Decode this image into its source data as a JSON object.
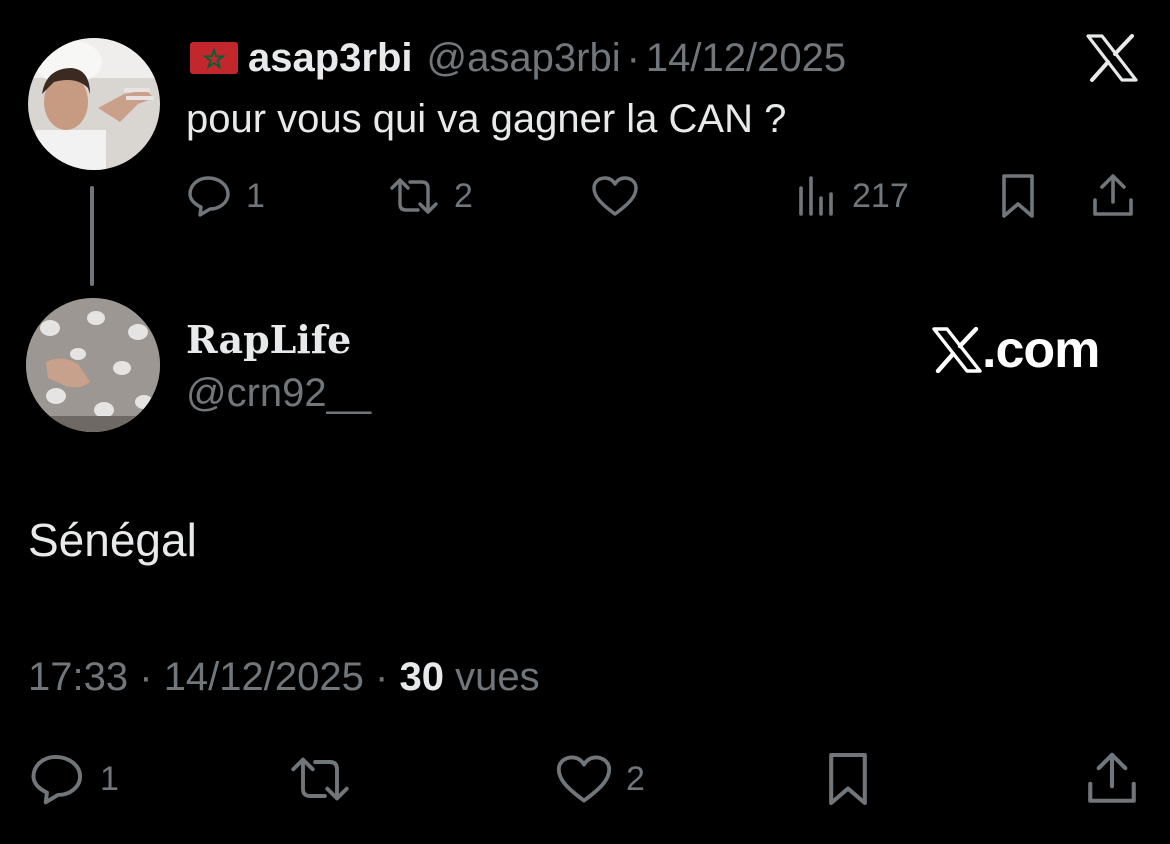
{
  "parent_tweet": {
    "author_name": "asap3rbi",
    "handle": "@asap3rbi",
    "separator": "·",
    "date": "14/12/2025",
    "text": "pour vous qui va gagner la CAN ?",
    "flag_icon": "morocco-flag-icon",
    "actions": {
      "reply_count": "1",
      "retweet_count": "2",
      "views_count": "217"
    }
  },
  "reply_tweet": {
    "author_name": "RapLife",
    "handle": "@crn92__",
    "text": "Sénégal",
    "time": "17:33",
    "separator": "·",
    "date": "14/12/2025",
    "views_number": "30",
    "views_label": "vues",
    "actions": {
      "reply_count": "1",
      "like_count": "2"
    }
  },
  "watermark": {
    "text": ".com",
    "logo_icon": "x-logo-icon"
  },
  "colors": {
    "background": "#000000",
    "primary_text": "#e7e9ea",
    "secondary_text": "#71767b",
    "flag_red": "#c1272d",
    "flag_green": "#006233"
  }
}
